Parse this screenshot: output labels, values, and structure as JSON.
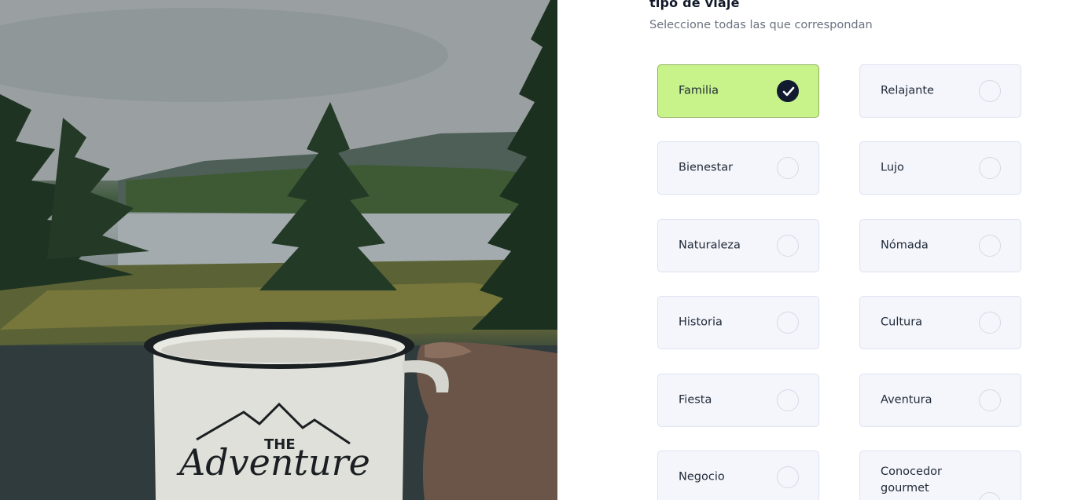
{
  "photo": {
    "mug_text_the": "THE",
    "mug_text_script": "Adventure"
  },
  "form": {
    "title": "tipo de viaje",
    "subtitle": "Seleccione todas las que correspondan",
    "options": [
      {
        "label": "Familia",
        "selected": true
      },
      {
        "label": "Relajante",
        "selected": false
      },
      {
        "label": "Bienestar",
        "selected": false
      },
      {
        "label": "Lujo",
        "selected": false
      },
      {
        "label": "Naturaleza",
        "selected": false
      },
      {
        "label": "Nómada",
        "selected": false
      },
      {
        "label": "Historia",
        "selected": false
      },
      {
        "label": "Cultura",
        "selected": false
      },
      {
        "label": "Fiesta",
        "selected": false
      },
      {
        "label": "Aventura",
        "selected": false
      },
      {
        "label": "Negocio",
        "selected": false
      },
      {
        "label": "Conocedor gourmet",
        "selected": false
      }
    ]
  },
  "colors": {
    "selected_bg": "#c7f38a",
    "option_bg": "#f5f6fb",
    "check_bg": "#111a2e"
  },
  "icons": {
    "selected": "check-circle-icon",
    "unselected": "empty-circle-icon"
  }
}
